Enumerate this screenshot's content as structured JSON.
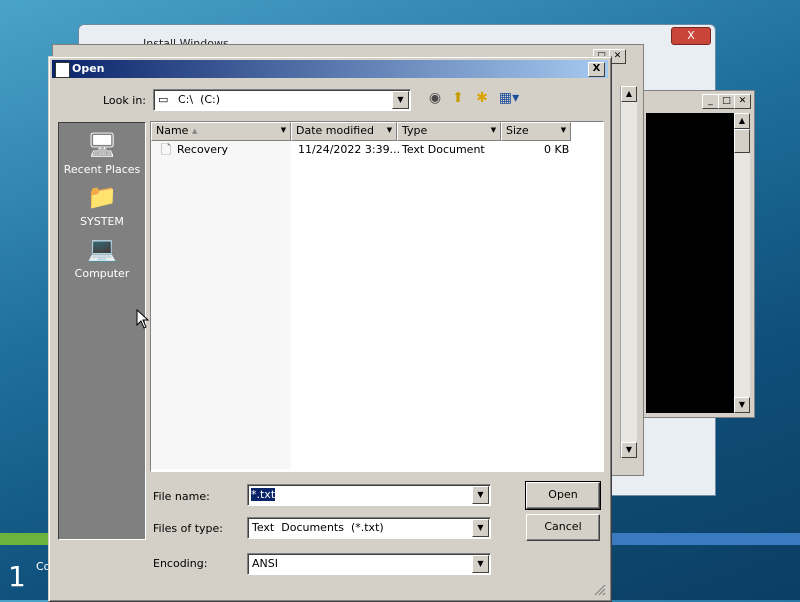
{
  "background": {
    "install_window": {
      "title": "Install Windows",
      "close_label": "X"
    },
    "notepad_window": {
      "title": ""
    },
    "progress": {
      "fraction": 0.67
    },
    "step": {
      "number": "1",
      "label": "Co"
    }
  },
  "dialog": {
    "title": "Open",
    "close_label": "X",
    "look_in": {
      "label": "Look in:",
      "value": "C:\\  (C:)"
    },
    "places": [
      {
        "label": "Recent Places",
        "icon": "recent-places-icon"
      },
      {
        "label": "SYSTEM",
        "icon": "user-folder-icon"
      },
      {
        "label": "Computer",
        "icon": "computer-icon"
      }
    ],
    "columns": [
      "Name",
      "Date modified",
      "Type",
      "Size"
    ],
    "files": [
      {
        "name": "Recovery",
        "date": "11/24/2022 3:39...",
        "type": "Text Document",
        "size": "0 KB"
      }
    ],
    "file_name": {
      "label": "File name:",
      "value": "*.txt"
    },
    "files_of_type": {
      "label": "Files of type:",
      "value": "Text  Documents  (*.txt)"
    },
    "encoding": {
      "label": "Encoding:",
      "value": "ANSI"
    },
    "buttons": {
      "open": "Open",
      "cancel": "Cancel"
    }
  },
  "colors": {
    "title_bar_start": "#0a246a",
    "title_bar_end": "#a6caf0",
    "places_bar": "#808080",
    "dialog_face": "#d4d0c8",
    "desktop": "#1f6f9c"
  }
}
